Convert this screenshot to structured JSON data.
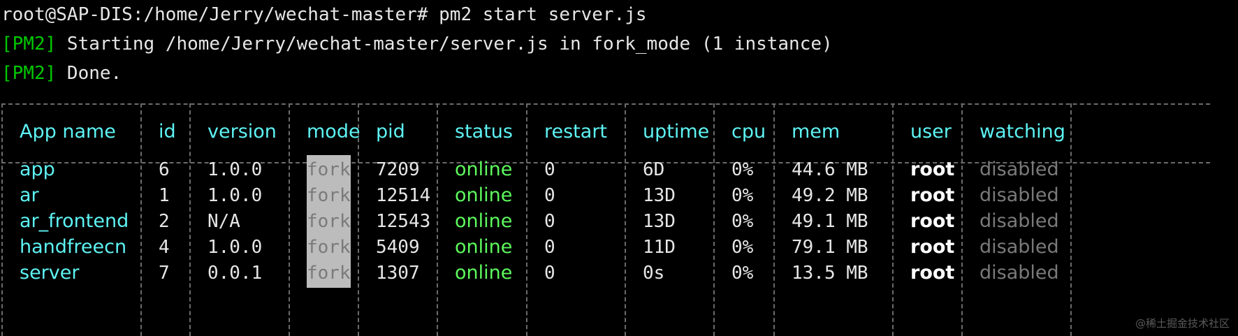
{
  "terminal": {
    "prompt_line": "root@SAP-DIS:/home/Jerry/wechat-master# pm2 start server.js",
    "log": [
      {
        "tag": "[PM2]",
        "text": " Starting /home/Jerry/wechat-master/server.js in fork_mode (1 instance)"
      },
      {
        "tag": "[PM2]",
        "text": " Done."
      }
    ]
  },
  "table": {
    "headers": {
      "app_name": "App name",
      "id": "id",
      "version": "version",
      "mode": "mode",
      "pid": "pid",
      "status": "status",
      "restart": "restart",
      "uptime": "uptime",
      "cpu": "cpu",
      "mem": "mem",
      "user": "user",
      "watching": "watching"
    },
    "rows": [
      {
        "app_name": "app",
        "id": "6",
        "version": "1.0.0",
        "mode": "fork",
        "pid": "7209",
        "status": "online",
        "restart": "0",
        "uptime": "6D",
        "cpu": "0%",
        "mem": "44.6 MB",
        "user": "root",
        "watching": "disabled"
      },
      {
        "app_name": "ar",
        "id": "1",
        "version": "1.0.0",
        "mode": "fork",
        "pid": "12514",
        "status": "online",
        "restart": "0",
        "uptime": "13D",
        "cpu": "0%",
        "mem": "49.2 MB",
        "user": "root",
        "watching": "disabled"
      },
      {
        "app_name": "ar_frontend",
        "id": "2",
        "version": "N/A",
        "mode": "fork",
        "pid": "12543",
        "status": "online",
        "restart": "0",
        "uptime": "13D",
        "cpu": "0%",
        "mem": "49.1 MB",
        "user": "root",
        "watching": "disabled"
      },
      {
        "app_name": "handfreecn",
        "id": "4",
        "version": "1.0.0",
        "mode": "fork",
        "pid": "5409",
        "status": "online",
        "restart": "0",
        "uptime": "11D",
        "cpu": "0%",
        "mem": "79.1 MB",
        "user": "root",
        "watching": "disabled"
      },
      {
        "app_name": "server",
        "id": "7",
        "version": "0.0.1",
        "mode": "fork",
        "pid": "1307",
        "status": "online",
        "restart": "0",
        "uptime": "0s",
        "cpu": "0%",
        "mem": "13.5 MB",
        "user": "root",
        "watching": "disabled"
      }
    ]
  },
  "watermark": "@稀土掘金技术社区",
  "colors": {
    "background": "#000000",
    "pm2_tag": "#00c800",
    "header": "#5ef3f3",
    "status_online": "#5dfa5d",
    "watching_disabled": "#7a7a7a",
    "mode_highlight": "#bcbcbc"
  }
}
